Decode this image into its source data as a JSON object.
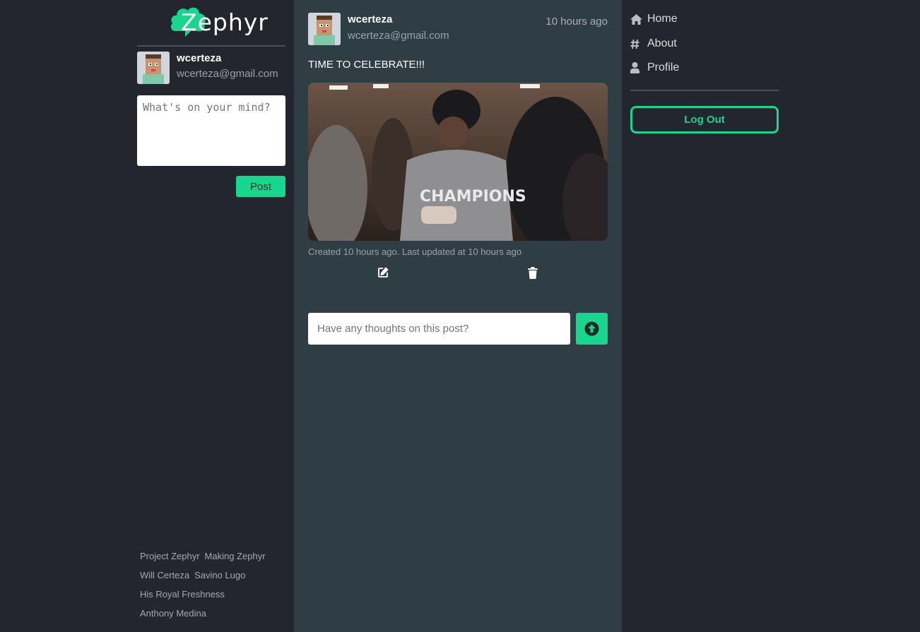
{
  "brand": {
    "name": "Zephyr",
    "accent": "#17d68e"
  },
  "current_user": {
    "username": "wcerteza",
    "email": "wcerteza@gmail.com"
  },
  "composer": {
    "placeholder": "What's on your mind?",
    "post_label": "Post"
  },
  "footer_links": [
    [
      "Project Zephyr",
      "Making Zephyr"
    ],
    [
      "Will Certeza",
      "Savino Lugo"
    ],
    [
      "His Royal Freshness"
    ],
    [
      "Anthony Medina"
    ]
  ],
  "post": {
    "username": "wcerteza",
    "email": "wcerteza@gmail.com",
    "time_ago": "10 hours ago",
    "text": "TIME TO CELEBRATE!!!",
    "image_icon": "celebration-photo",
    "meta": "Created 10 hours ago. Last updated at 10 hours ago",
    "edit_icon": "edit-icon",
    "delete_icon": "trash-icon"
  },
  "comment": {
    "placeholder": "Have any thoughts on this post?",
    "send_icon": "arrow-up-circle-icon"
  },
  "nav": [
    {
      "label": "Home",
      "icon": "home-icon"
    },
    {
      "label": "About",
      "icon": "hash-icon"
    },
    {
      "label": "Profile",
      "icon": "user-icon"
    }
  ],
  "logout_label": "Log Out"
}
